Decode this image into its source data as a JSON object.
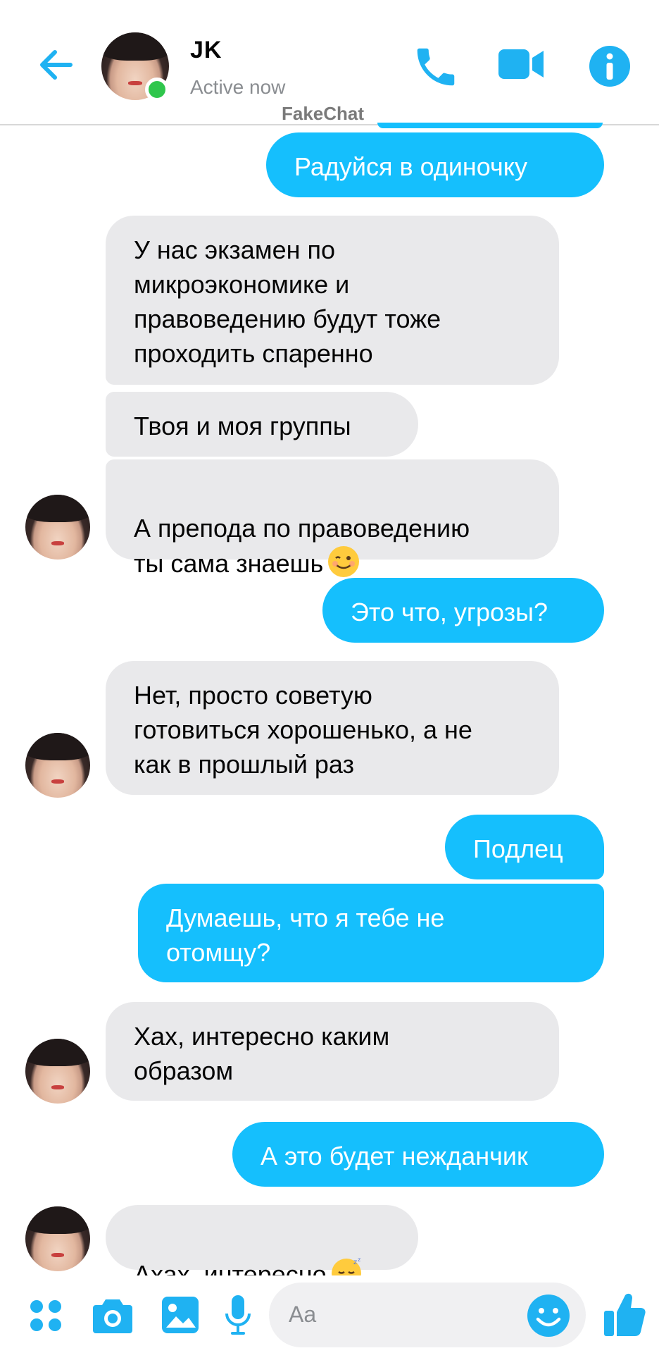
{
  "header": {
    "contact_name": "JK",
    "contact_status": "Active now",
    "watermark": "FakeChat"
  },
  "messages": [
    {
      "from": "me",
      "text": "Радуйся в одиночку"
    },
    {
      "from": "contact",
      "text": "У нас экзамен по\nмикроэкономике и\nправоведению будут тоже\nпроходить спаренно"
    },
    {
      "from": "contact",
      "text": "Твоя и моя группы"
    },
    {
      "from": "contact",
      "text": "А препода по правоведению\nты сама знаешь",
      "emoji": "winking-face"
    },
    {
      "from": "me",
      "text": "Это что, угрозы?"
    },
    {
      "from": "contact",
      "text": "Нет, просто советую\nготовиться хорошенько, а не\nкак в прошлый раз"
    },
    {
      "from": "me",
      "text": "Подлец"
    },
    {
      "from": "me",
      "text": "Думаешь, что я тебе не\nотомщу?"
    },
    {
      "from": "contact",
      "text": "Хах, интересно каким\nобразом"
    },
    {
      "from": "me",
      "text": "А это будет нежданчик"
    },
    {
      "from": "contact",
      "text": "Ахах, интересно",
      "emoji": "sleeping-face"
    }
  ],
  "composer": {
    "placeholder": "Aa",
    "icons": [
      "apps-icon",
      "camera-icon",
      "gallery-icon",
      "microphone-icon",
      "emoji-icon",
      "thumbs-up-icon"
    ]
  },
  "colors": {
    "accent": "#15bffd",
    "icon_blue": "#1fb2f2",
    "incoming_bubble": "#e9e9eb",
    "online": "#2fc64c"
  }
}
